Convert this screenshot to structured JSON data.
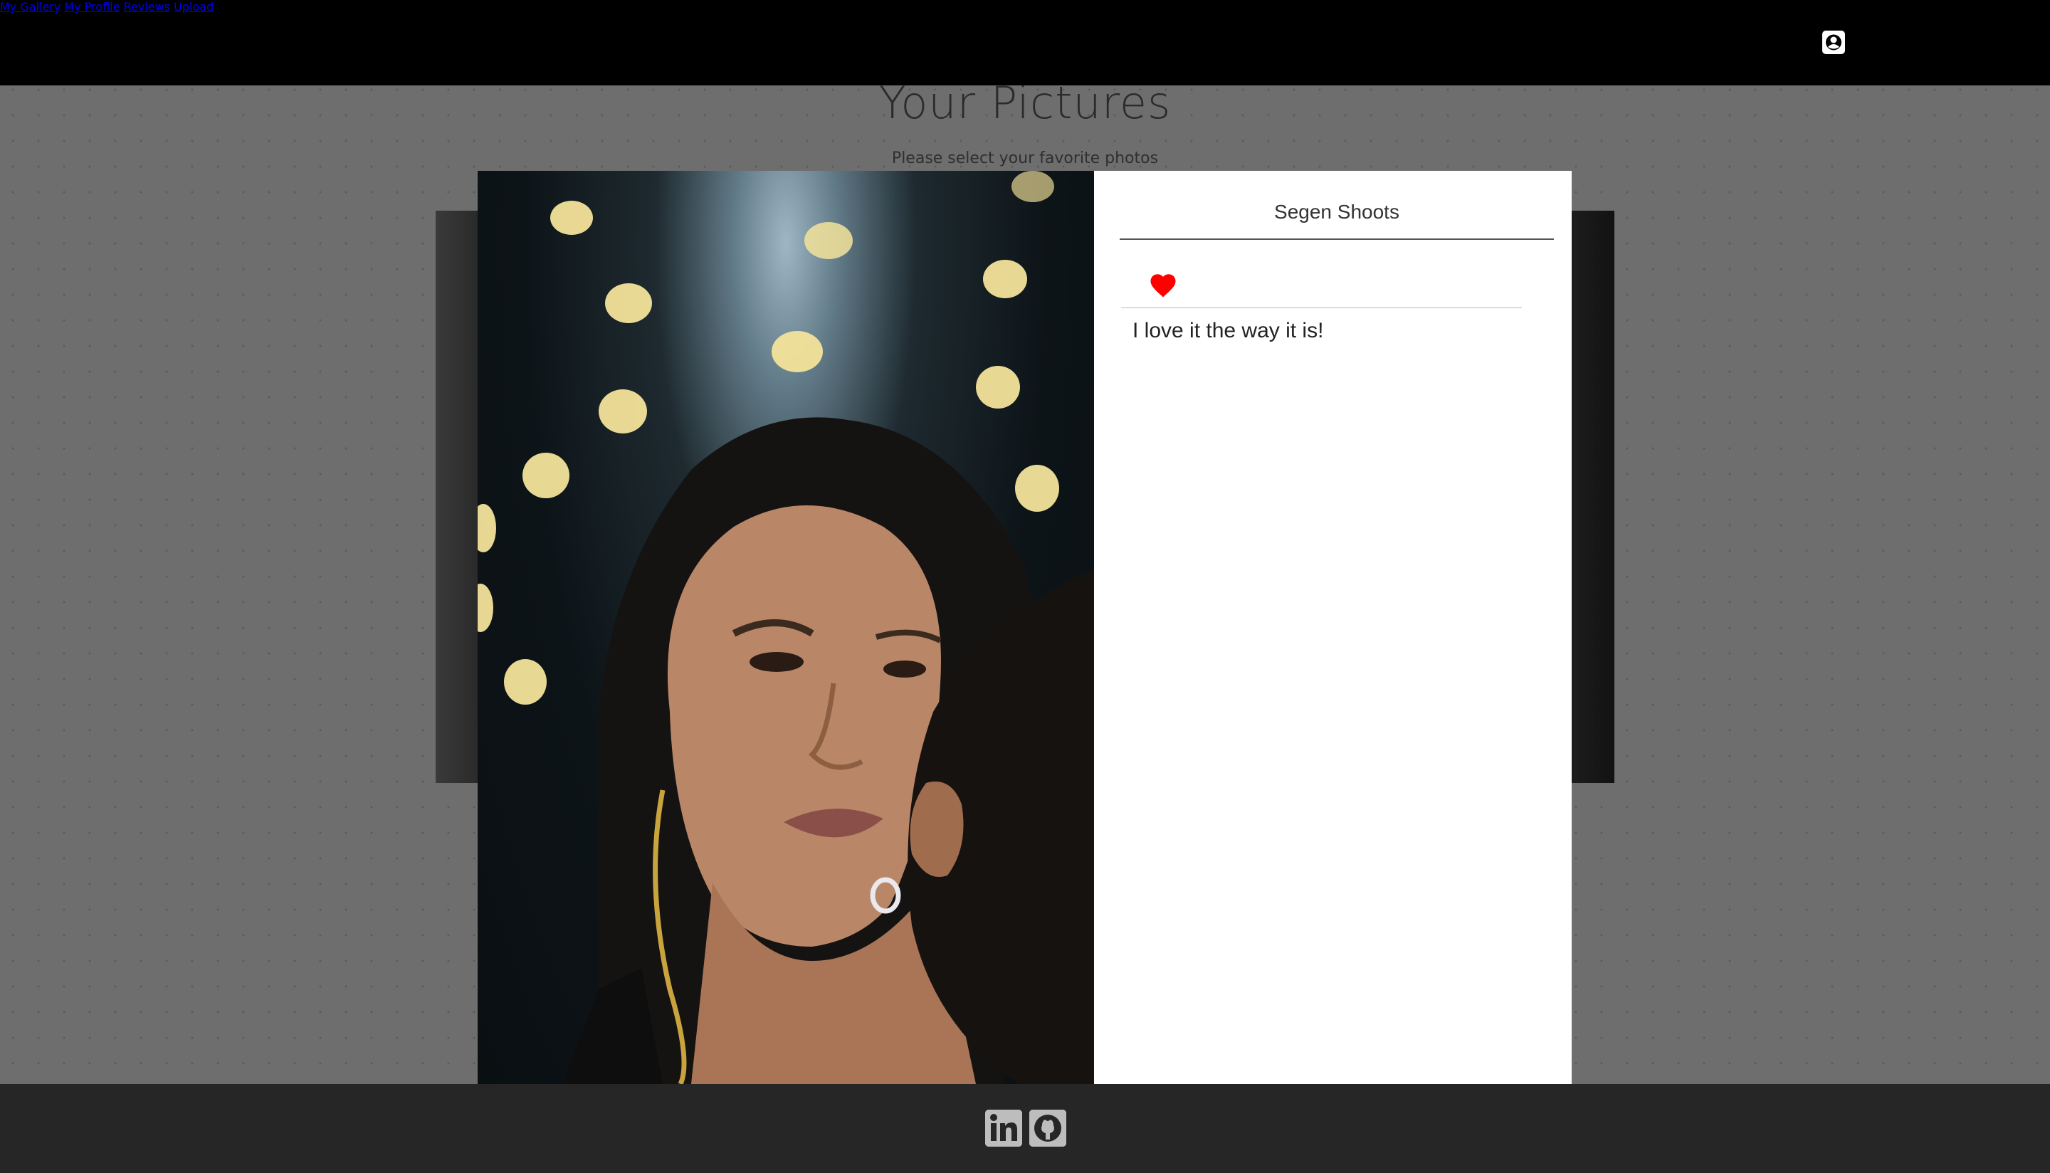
{
  "nav": {
    "items": [
      {
        "label": "My Gallery"
      },
      {
        "label": "My Profile"
      },
      {
        "label": "Reviews"
      },
      {
        "label": "Upload"
      }
    ],
    "user_icon": "user-icon"
  },
  "page": {
    "title": "Your Pictures",
    "subtitle": "Please select your favorite photos"
  },
  "modal": {
    "title": "Segen Shoots",
    "liked": true,
    "review": "I love it the way it is!"
  },
  "footer": {
    "icons": [
      "linkedin-icon",
      "github-icon"
    ]
  },
  "colors": {
    "topbar": "#000000",
    "heart": "#ff0000",
    "footer": "#262626"
  }
}
